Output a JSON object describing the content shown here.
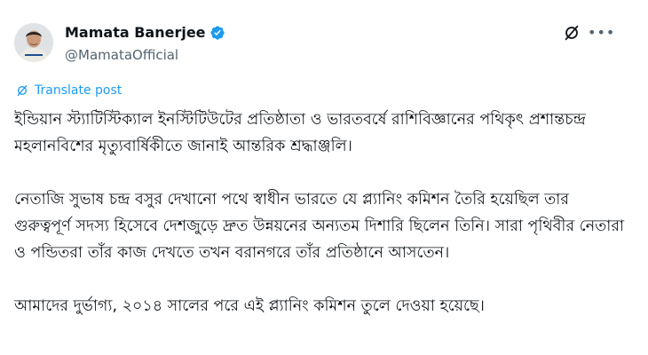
{
  "author": {
    "name": "Mamata Banerjee",
    "handle": "@MamataOfficial",
    "verified": true
  },
  "icons": {
    "verified": "verified-badge-icon",
    "grok": "grok-icon",
    "more": "more-options-icon",
    "translate": "translate-icon"
  },
  "colors": {
    "accent": "#1d9bf0",
    "text": "#0f1419",
    "secondary": "#536471"
  },
  "translate_label": "Translate post",
  "paragraphs": [
    "ইন্ডিয়ান স্ট্যাটিস্টিক্যাল ইনস্টিটিউটের প্রতিষ্ঠাতা ও ভারতবর্ষে রাশিবিজ্ঞানের পথিকৃৎ প্রশান্তচন্দ্র মহলানবিশের মৃত্যুবার্ষিকীতে জানাই আন্তরিক শ্রদ্ধাঞ্জলি।",
    "নেতাজি সুভাষ চন্দ্র বসুর দেখানো পথে স্বাধীন ভারতে যে প্ল্যানিং কমিশন তৈরি হয়েছিল তার গুরুত্বপূর্ণ সদস্য হিসেবে দেশজুড়ে দ্রুত উন্নয়নের অন্যতম দিশারি ছিলেন তিনি। সারা পৃথিবীর নেতারা ও পন্ডিতরা তাঁর কাজ দেখতে তখন বরানগরে তাঁর প্রতিষ্ঠানে আসতেন।",
    "আমাদের দুর্ভাগ্য, ২০১৪ সালের পরে এই প্ল্যানিং কমিশন তুলে দেওয়া হয়েছে।"
  ]
}
